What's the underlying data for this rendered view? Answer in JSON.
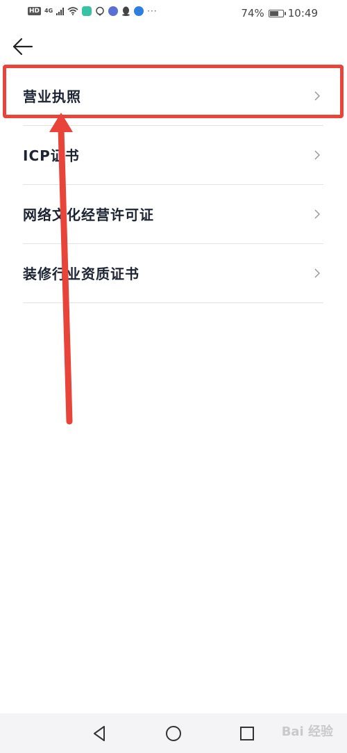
{
  "status_bar": {
    "network_badge": "HD",
    "network_type": "4G",
    "more_indicator": "···",
    "battery_percent": "74%",
    "battery_level": 0.74,
    "time": "10:49"
  },
  "header": {
    "back_icon": "arrow-left-icon"
  },
  "list": {
    "items": [
      {
        "label": "营业执照",
        "chevron_icon": "chevron-right-icon"
      },
      {
        "label": "ICP证书",
        "chevron_icon": "chevron-right-icon"
      },
      {
        "label": "网络文化经营许可证",
        "chevron_icon": "chevron-right-icon"
      },
      {
        "label": "装修行业资质证书",
        "chevron_icon": "chevron-right-icon"
      }
    ]
  },
  "annotation": {
    "color": "#e8443a"
  },
  "nav_bar": {
    "back_icon": "triangle-back-icon",
    "home_icon": "circle-home-icon",
    "recents_icon": "square-recents-icon",
    "watermark": "Bai 经验"
  }
}
